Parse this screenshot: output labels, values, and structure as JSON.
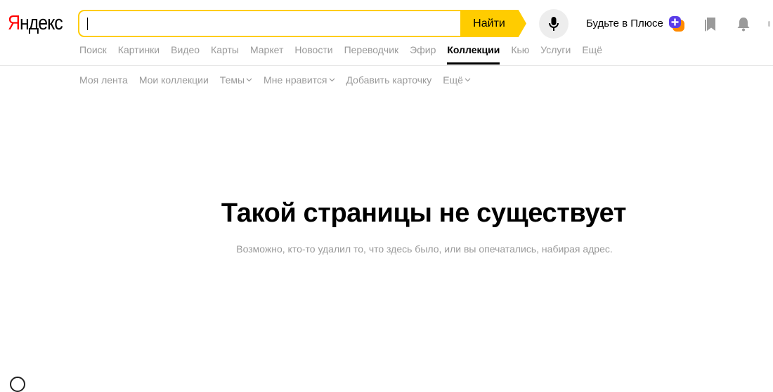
{
  "logo": {
    "first_letter": "Я",
    "rest": "ндекс"
  },
  "search": {
    "value": "",
    "placeholder": "",
    "button_label": "Найти"
  },
  "header": {
    "plus_promo": "Будьте в Плюсе"
  },
  "services": [
    {
      "label": "Поиск"
    },
    {
      "label": "Картинки"
    },
    {
      "label": "Видео"
    },
    {
      "label": "Карты"
    },
    {
      "label": "Маркет"
    },
    {
      "label": "Новости"
    },
    {
      "label": "Переводчик"
    },
    {
      "label": "Эфир"
    },
    {
      "label": "Коллекции",
      "active": true
    },
    {
      "label": "Кью"
    },
    {
      "label": "Услуги"
    },
    {
      "label": "Ещё"
    }
  ],
  "subnav": [
    {
      "label": "Моя лента"
    },
    {
      "label": "Мои коллекции"
    },
    {
      "label": "Темы",
      "dropdown": true
    },
    {
      "label": "Мне нравится",
      "dropdown": true
    },
    {
      "label": "Добавить карточку"
    },
    {
      "label": "Ещё",
      "dropdown": true
    }
  ],
  "error": {
    "title": "Такой страницы не существует",
    "message": "Возможно, кто-то удалил то, что здесь было, или вы опечатались, набирая адрес."
  },
  "icons": {
    "mic": "microphone-icon",
    "plus": "plus-badge-icon",
    "bookmark": "bookmark-icon",
    "bell": "bell-icon",
    "chevron": "chevron-down-icon"
  },
  "colors": {
    "accent": "#ffcc00",
    "logo_red": "#ff0000",
    "muted_text": "#999999",
    "plus_purple": "#5b3ee8",
    "plus_orange": "#ff8a00"
  }
}
